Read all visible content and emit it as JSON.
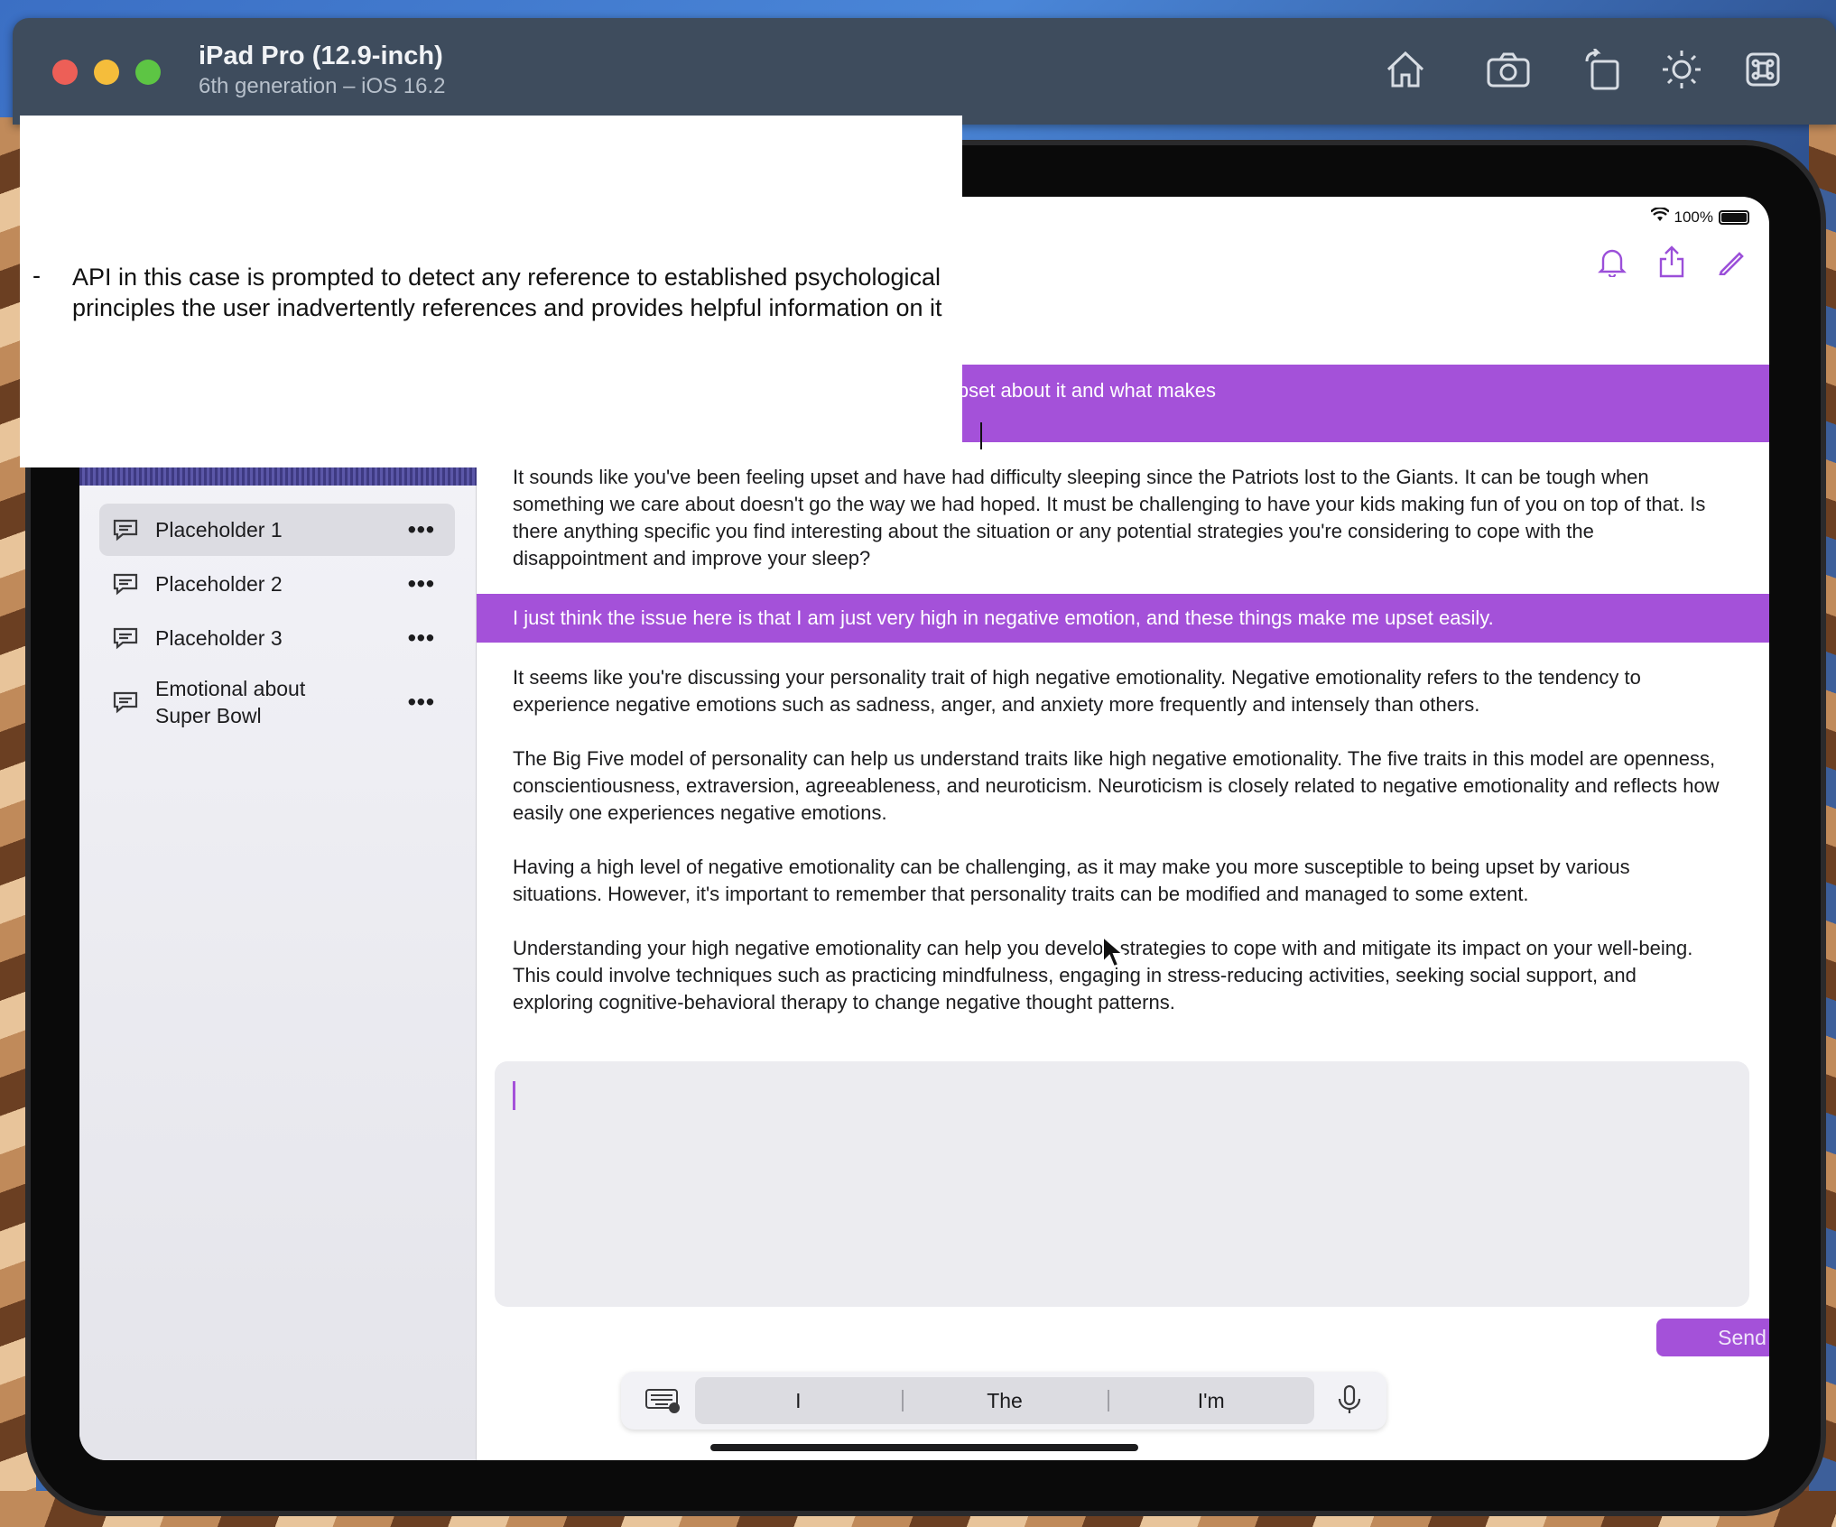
{
  "window": {
    "title": "iPad Pro (12.9-inch)",
    "subtitle": "6th generation – iOS 16.2",
    "toolbar_icons": [
      "home-icon",
      "screenshot-icon",
      "rotate-icon",
      "appearance-icon",
      "command-icon"
    ]
  },
  "status_bar": {
    "battery": "100%"
  },
  "annotation": {
    "bullet": "-",
    "text": "API in this case is prompted to detect any reference to established psychological principles the user inadvertently references and provides helpful information on it"
  },
  "header": {
    "icons": [
      "bell-icon",
      "share-icon",
      "edit-icon"
    ]
  },
  "sidebar": {
    "items": [
      {
        "label": "Placeholder 1",
        "menu": "•••"
      },
      {
        "label": "Placeholder 2",
        "menu": "•••"
      },
      {
        "label": "Placeholder 3",
        "menu": "•••"
      },
      {
        "label_line1": "Emotional about",
        "label_line2": "Super Bowl",
        "menu": "•••"
      }
    ]
  },
  "messages": {
    "user_1": "game, I just have not been able to sleep. I am so upset about it and what makes",
    "ai_1": "It sounds like you've been feeling upset and have had difficulty sleeping since the Patriots lost to the Giants. It can be tough when something we care about doesn't go the way we had hoped. It must be challenging to have your kids making fun of you on top of that. Is there anything specific you find interesting about the situation or any potential strategies you're considering to cope with the disappointment and improve your sleep?",
    "user_2": "I just think the issue here is that I am just very high in negative emotion, and these things make me upset easily.",
    "ai_2": [
      "It seems like you're discussing your personality trait of high negative emotionality. Negative emotionality refers to the tendency to experience negative emotions such as sadness, anger, and anxiety more frequently and intensely than others.",
      "The Big Five model of personality can help us understand traits like high negative emotionality. The five traits in this model are openness, conscientiousness, extraversion, agreeableness, and neuroticism. Neuroticism is closely related to negative emotionality and reflects how easily one experiences negative emotions.",
      "Having a high level of negative emotionality can be challenging, as it may make you more susceptible to being upset by various situations. However, it's important to remember that personality traits can be modified and managed to some extent.",
      "Understanding your high negative emotionality can help you develop strategies to cope with and mitigate its impact on your well-being. This could involve techniques such as practicing mindfulness, engaging in stress-reducing activities, seeking social support, and exploring cognitive-behavioral therapy to change negative thought patterns."
    ]
  },
  "composer": {
    "value": "",
    "send_label": "Send"
  },
  "predictive": {
    "words": [
      "I",
      "The",
      "I'm"
    ]
  },
  "colors": {
    "accent": "#a451d9",
    "sidebar_bg": "#f2f2f7"
  }
}
